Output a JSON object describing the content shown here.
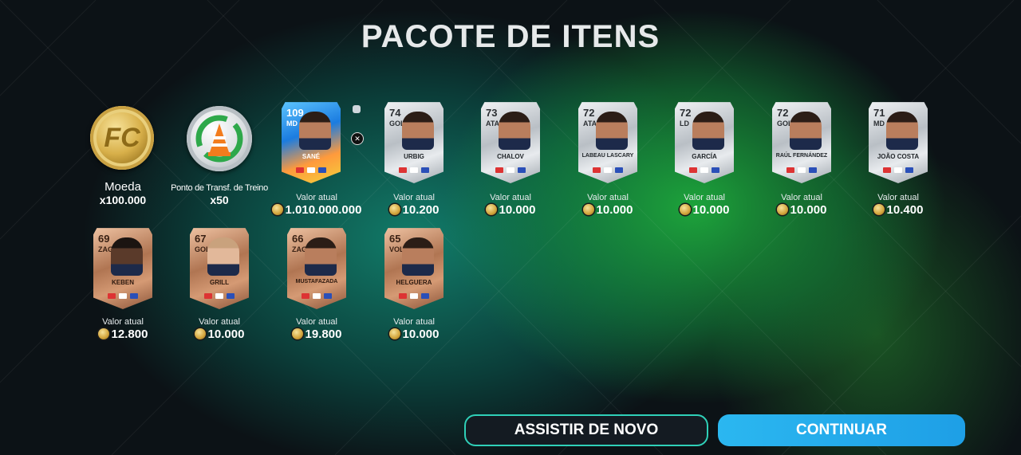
{
  "title": "PACOTE DE ITENS",
  "rewards": [
    {
      "type": "coin",
      "label": "Moeda",
      "quantity": "x100.000",
      "icon": "fc-coin-icon"
    },
    {
      "type": "training",
      "label": "Ponto de Transf. de Treino",
      "quantity": "x50",
      "icon": "training-transfer-icon"
    }
  ],
  "value_label": "Valor atual",
  "players": [
    {
      "rating": "109",
      "position": "MD",
      "name": "SANÉ",
      "value": "1.010.000.000",
      "tier": "special"
    },
    {
      "rating": "74",
      "position": "GOL",
      "name": "URBIG",
      "value": "10.200",
      "tier": "silver"
    },
    {
      "rating": "73",
      "position": "ATA",
      "name": "CHALOV",
      "value": "10.000",
      "tier": "silver"
    },
    {
      "rating": "72",
      "position": "ATA",
      "name": "LABEAU LASCARY",
      "value": "10.000",
      "tier": "silver"
    },
    {
      "rating": "72",
      "position": "LD",
      "name": "GARCÍA",
      "value": "10.000",
      "tier": "silver"
    },
    {
      "rating": "72",
      "position": "GOL",
      "name": "RAÚL FERNÁNDEZ",
      "value": "10.000",
      "tier": "silver"
    },
    {
      "rating": "71",
      "position": "MD",
      "name": "JOÃO COSTA",
      "value": "10.400",
      "tier": "silver"
    },
    {
      "rating": "69",
      "position": "ZAG",
      "name": "KEBEN",
      "value": "12.800",
      "tier": "bronze"
    },
    {
      "rating": "67",
      "position": "GOL",
      "name": "GRILL",
      "value": "10.000",
      "tier": "bronze"
    },
    {
      "rating": "66",
      "position": "ZAG",
      "name": "MUSTAFAZADA",
      "value": "19.800",
      "tier": "bronze"
    },
    {
      "rating": "65",
      "position": "VOL",
      "name": "HELGUERA",
      "value": "10.000",
      "tier": "bronze"
    }
  ],
  "buttons": {
    "replay": "ASSISTIR DE NOVO",
    "continue": "CONTINUAR"
  },
  "colors": {
    "accent_green": "#1fae3c",
    "accent_teal": "#138270",
    "continue_button": "#2bb7f0",
    "replay_border": "#2fd0b8"
  }
}
